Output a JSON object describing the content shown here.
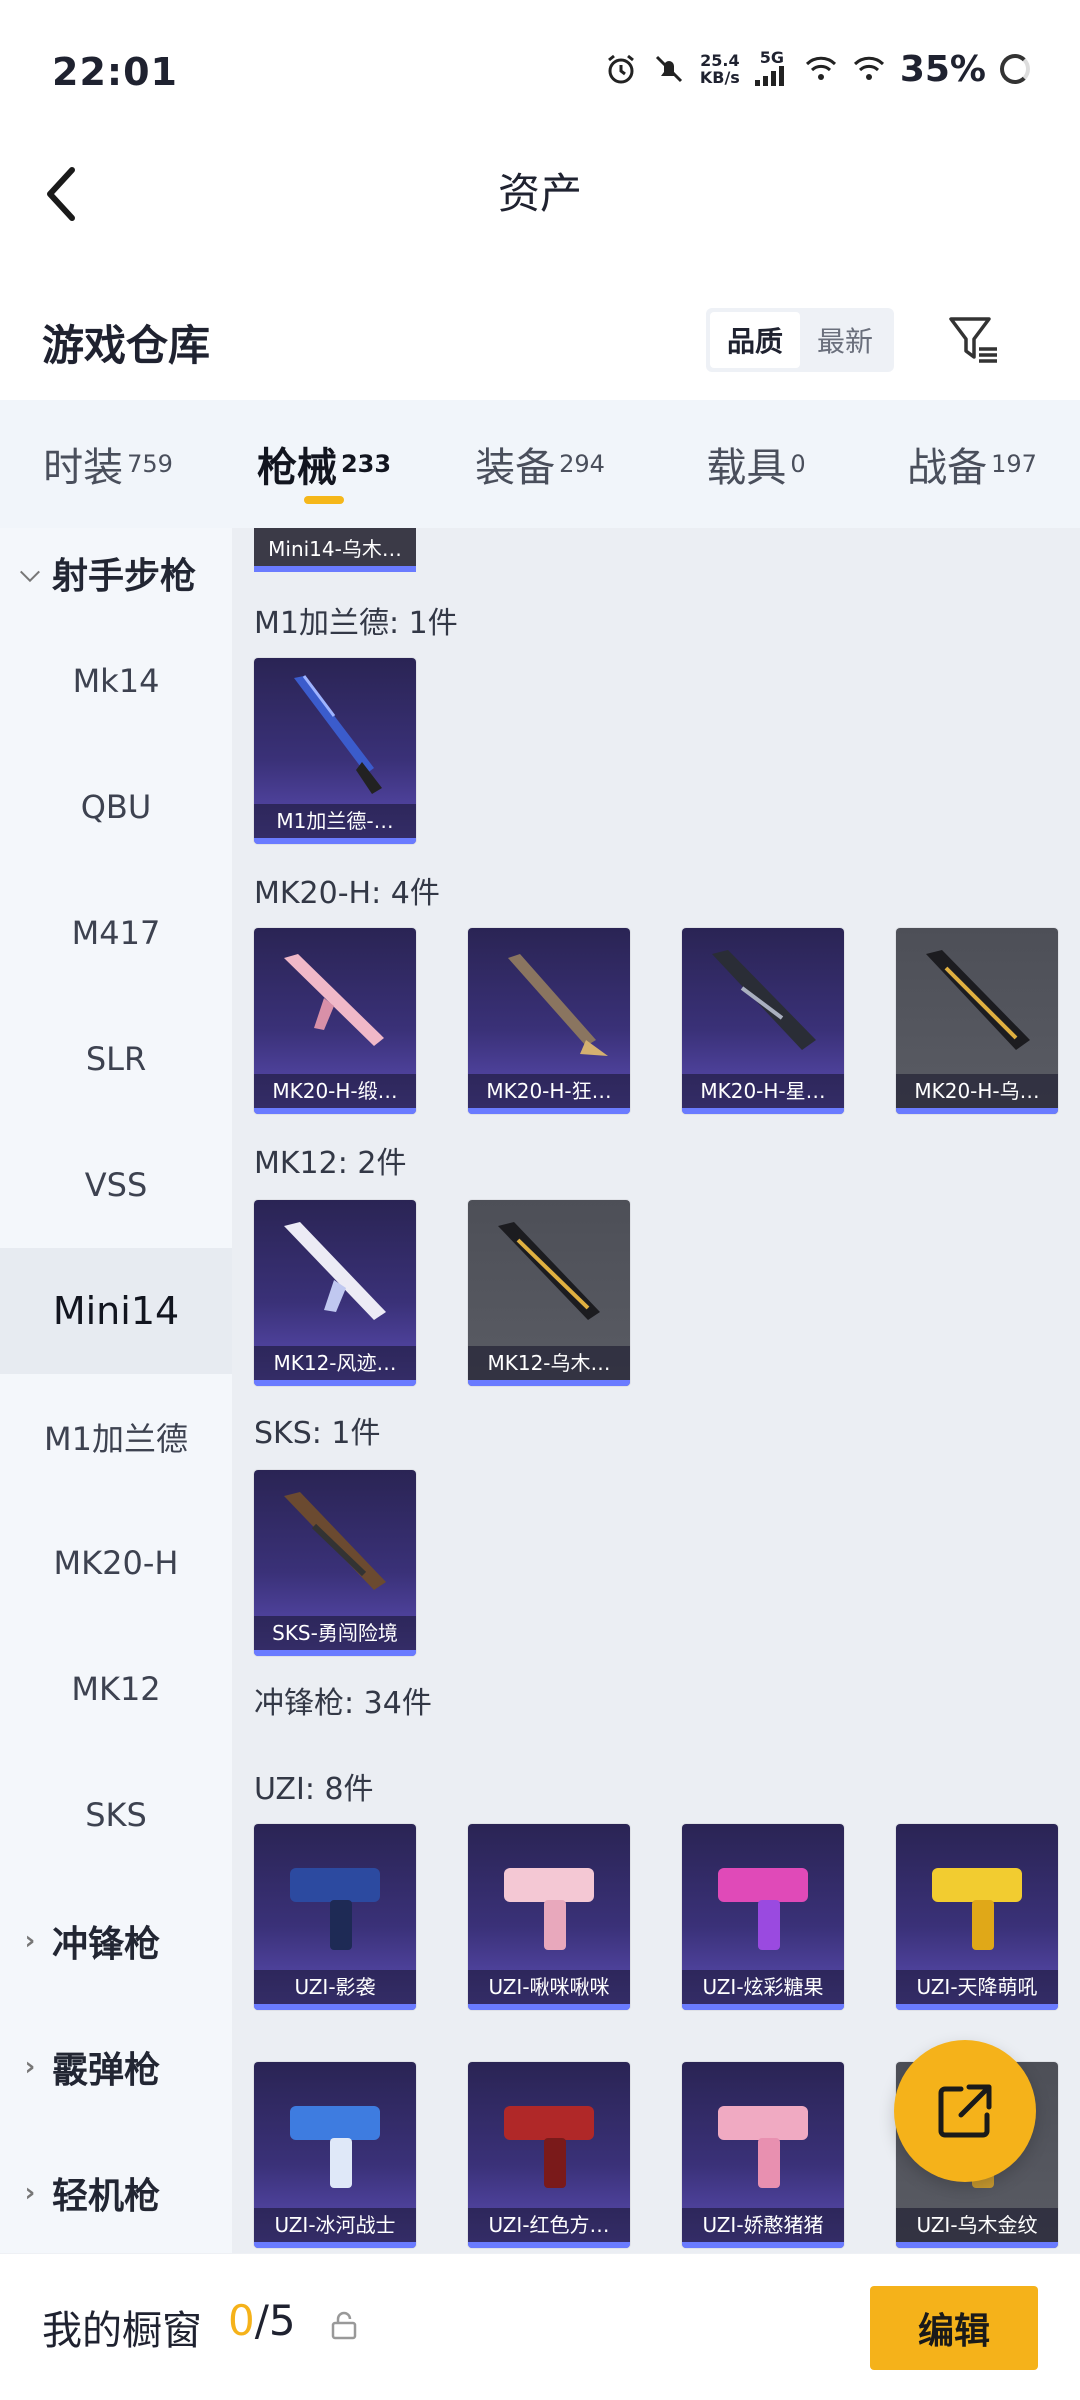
{
  "status_bar": {
    "time": "22:01",
    "net_speed_value": "25.4",
    "net_speed_unit": "KB/s",
    "network_type": "5G",
    "battery": "35%"
  },
  "header": {
    "title": "资产"
  },
  "warehouse": {
    "title": "游戏仓库",
    "sort_quality": "品质",
    "sort_newest": "最新"
  },
  "tabs": [
    {
      "label": "时装",
      "count": "759"
    },
    {
      "label": "枪械",
      "count": "233"
    },
    {
      "label": "装备",
      "count": "294"
    },
    {
      "label": "载具",
      "count": "0"
    },
    {
      "label": "战备",
      "count": "197"
    }
  ],
  "sidebar": {
    "items": [
      {
        "label": "射手步枪",
        "chev": "⌵"
      },
      {
        "label": "Mk14"
      },
      {
        "label": "QBU"
      },
      {
        "label": "M417"
      },
      {
        "label": "SLR"
      },
      {
        "label": "VSS"
      },
      {
        "label": "Mini14"
      },
      {
        "label": "M1加兰德"
      },
      {
        "label": "MK20-H"
      },
      {
        "label": "MK12"
      },
      {
        "label": "SKS"
      },
      {
        "label": "冲锋枪",
        "chev": "›"
      },
      {
        "label": "霰弹枪",
        "chev": "›"
      },
      {
        "label": "轻机枪",
        "chev": "›"
      }
    ]
  },
  "content": {
    "partial_top_label": "Mini14-乌木…",
    "groups": [
      {
        "title": "M1加兰德: 1件",
        "items": [
          "M1加兰德-…"
        ]
      },
      {
        "title": "MK20-H: 4件",
        "items": [
          "MK20-H-缎…",
          "MK20-H-狂…",
          "MK20-H-星…",
          "MK20-H-乌…"
        ]
      },
      {
        "title": "MK12: 2件",
        "items": [
          "MK12-风迹…",
          "MK12-乌木…"
        ]
      },
      {
        "title": "SKS: 1件",
        "items": [
          "SKS-勇闯险境"
        ]
      },
      {
        "title": "冲锋枪: 34件"
      },
      {
        "title": "UZI: 8件",
        "items": [
          "UZI-影袭",
          "UZI-啾咪啾咪",
          "UZI-炫彩糖果",
          "UZI-天降萌吼",
          "UZI-冰河战士",
          "UZI-红色方…",
          "UZI-娇憨猪猪",
          "UZI-乌木金纹"
        ]
      }
    ]
  },
  "bottom_bar": {
    "label": "我的橱窗",
    "current": "0",
    "total": "/5",
    "edit": "编辑"
  },
  "colors": {
    "accent": "#f5b21a",
    "card_purple": "#3a3178",
    "card_gray": "#55575f",
    "quality_bar": "#6a7bff"
  },
  "icons": [
    "back-arrow-icon",
    "filter-icon",
    "share-icon",
    "lock-icon",
    "alarm-icon",
    "mute-icon",
    "wifi-icon",
    "signal-icon"
  ]
}
